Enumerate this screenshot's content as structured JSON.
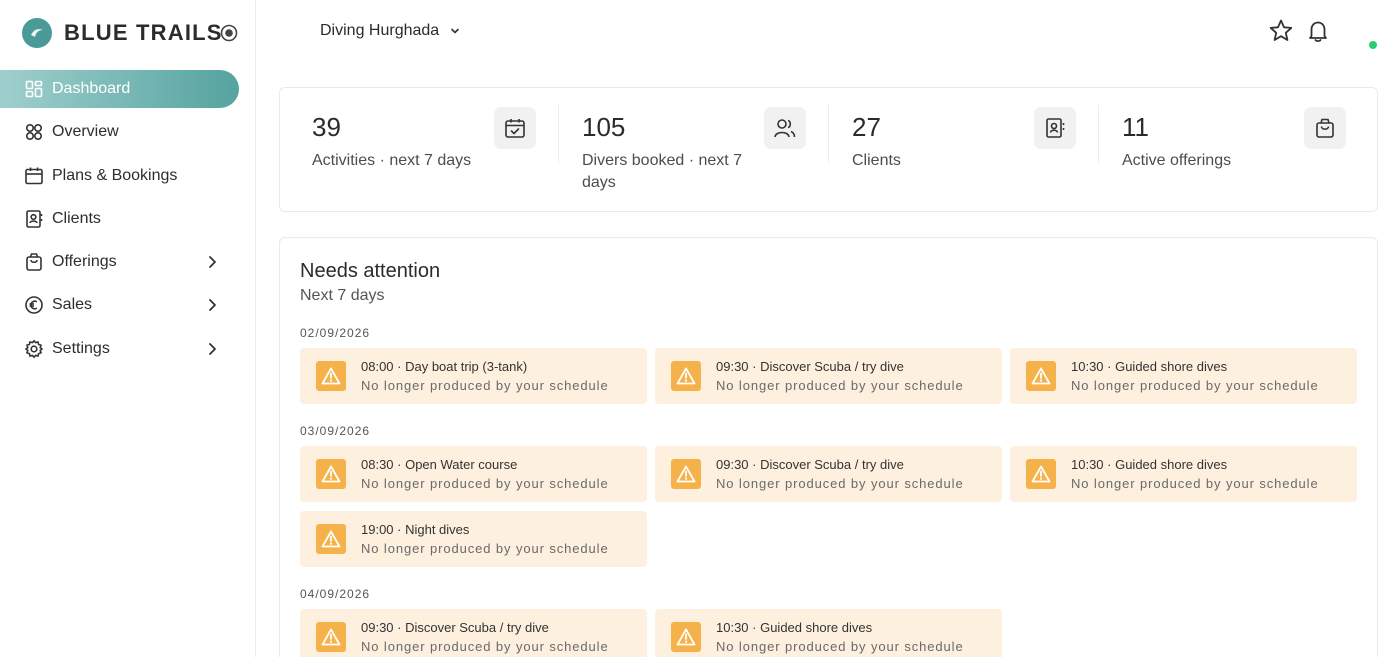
{
  "brand": {
    "name": "BLUE TRAILS",
    "logo_text": "BLUE TRAILS",
    "accent": "#4a9a98"
  },
  "sidebar": {
    "items": [
      {
        "label": "Dashboard",
        "icon": "dashboard-icon",
        "active": true
      },
      {
        "label": "Overview",
        "icon": "overview-icon"
      },
      {
        "label": "Plans & Bookings",
        "icon": "calendar-icon"
      },
      {
        "label": "Clients",
        "icon": "contacts-icon"
      },
      {
        "label": "Offerings",
        "icon": "shopping-bag-icon",
        "has_submenu": true
      },
      {
        "label": "Sales",
        "icon": "euro-icon",
        "has_submenu": true
      },
      {
        "label": "Settings",
        "icon": "gear-icon",
        "has_submenu": true
      }
    ]
  },
  "header": {
    "location": "Diving Hurghada",
    "status_color": "#2ecc71"
  },
  "stats": [
    {
      "value": "39",
      "label": "Activities · next 7 days",
      "icon": "calendar-check-icon"
    },
    {
      "value": "105",
      "label": "Divers booked · next 7 days",
      "icon": "users-icon"
    },
    {
      "value": "27",
      "label": "Clients",
      "icon": "contacts-icon"
    },
    {
      "value": "11",
      "label": "Active offerings",
      "icon": "shopping-bag-icon"
    }
  ],
  "attention": {
    "title": "Needs attention",
    "subtitle": "Next 7 days",
    "alert_color": "#f6b24a",
    "groups": [
      {
        "date": "02/09/2026",
        "items": [
          {
            "title": "08:00 · Day boat trip (3-tank)",
            "desc": "No longer produced by your schedule"
          },
          {
            "title": "09:30 · Discover Scuba / try dive",
            "desc": "No longer produced by your schedule"
          },
          {
            "title": "10:30 · Guided shore dives",
            "desc": "No longer produced by your schedule"
          }
        ]
      },
      {
        "date": "03/09/2026",
        "items": [
          {
            "title": "08:30 · Open Water course",
            "desc": "No longer produced by your schedule"
          },
          {
            "title": "09:30 · Discover Scuba / try dive",
            "desc": "No longer produced by your schedule"
          },
          {
            "title": "10:30 · Guided shore dives",
            "desc": "No longer produced by your schedule"
          },
          {
            "title": "19:00 · Night dives",
            "desc": "No longer produced by your schedule"
          }
        ]
      },
      {
        "date": "04/09/2026",
        "items": [
          {
            "title": "09:30 · Discover Scuba / try dive",
            "desc": "No longer produced by your schedule"
          },
          {
            "title": "10:30 · Guided shore dives",
            "desc": "No longer produced by your schedule"
          }
        ]
      }
    ]
  }
}
